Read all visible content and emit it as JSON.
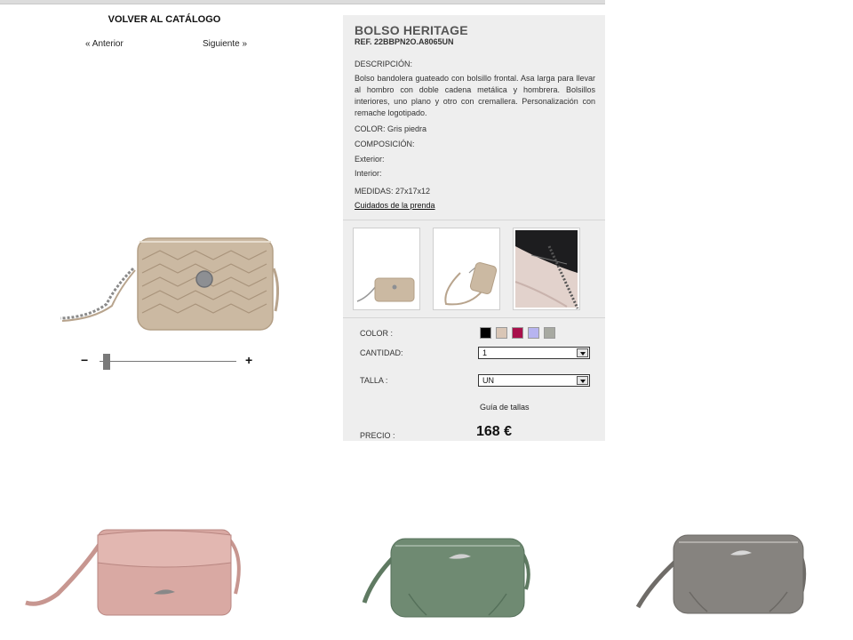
{
  "nav": {
    "back_label": "VOLVER AL CATÁLOGO",
    "prev_label": "« Anterior",
    "next_label": "Siguiente »"
  },
  "zoom": {
    "minus": "−",
    "plus": "+",
    "level": 0.03
  },
  "product": {
    "title": "BOLSO HERITAGE",
    "ref": "REF. 22BBPN2O.A8065UN",
    "description_label": "DESCRIPCIÓN:",
    "description": "Bolso bandolera guateado con bolsillo frontal. Asa larga para llevar al hombro con doble cadena metálica y hombrera. Bolsillos interiores, uno plano y otro con cremallera. Personalización con remache logotipado.",
    "color_text": "COLOR: Gris piedra",
    "composition_label": "COMPOSICIÓN:",
    "exterior_label": "Exterior:",
    "interior_label": "Interior:",
    "measures": "MEDIDAS: 27x17x12",
    "care_link": "Cuidados de la prenda"
  },
  "options": {
    "color_label": "COLOR :",
    "swatches": [
      "#000000",
      "#d9c6b6",
      "#a8104b",
      "#b7b4f0",
      "#a7a9a1"
    ],
    "quantity_label": "CANTIDAD:",
    "quantity_value": "1",
    "size_label": "TALLA :",
    "size_value": "UN",
    "size_guide": "Guía de tallas",
    "price_label": "PRECIO :",
    "price": "168 €"
  },
  "colors": {
    "panel_bg": "#eeeeee",
    "bag_main": "#cbb9a2",
    "bag_pink": "#d9a9a3",
    "bag_green": "#6f8a72",
    "bag_grey": "#86837f"
  },
  "icons": {
    "zoom_out": "minus-icon",
    "zoom_in": "plus-icon",
    "dropdown": "chevron-down-icon"
  }
}
